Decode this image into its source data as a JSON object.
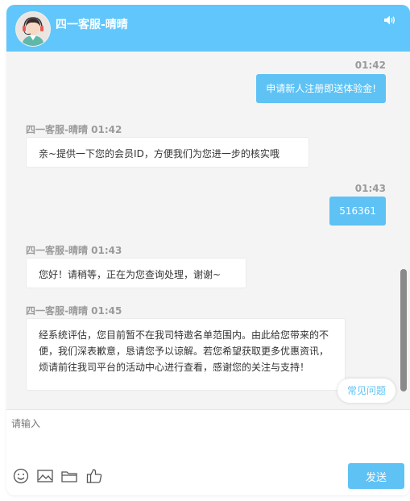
{
  "header": {
    "agent_name": "四一客服-晴晴",
    "avatar_icon": "agent-avatar-icon",
    "sound_icon": "speaker-icon",
    "background_color": "#61c6fb"
  },
  "messages": [
    {
      "from": "user",
      "time": "01:42",
      "text": "申请新人注册即送体验金!"
    },
    {
      "from": "agent",
      "meta": "四一客服-晴晴 01:42",
      "text": "亲~提供一下您的会员ID，方便我们为您进一步的核实哦"
    },
    {
      "from": "user",
      "time": "01:43",
      "text": "516361"
    },
    {
      "from": "agent",
      "meta": "四一客服-晴晴 01:43",
      "text": "您好！请稍等，正在为您查询处理，谢谢~"
    },
    {
      "from": "agent",
      "meta": "四一客服-晴晴 01:45",
      "text": "经系统评估，您目前暂不在我司特邀名单范围内。由此给您带来的不便，我们深表歉意，恳请您予以谅解。若您希望获取更多优惠资讯，烦请前往我司平台的活动中心进行查看，感谢您的关注与支持！"
    }
  ],
  "faq_label": "常见问题",
  "input": {
    "placeholder": "请输入",
    "value": ""
  },
  "toolbar": {
    "icons": [
      "emoji-icon",
      "image-icon",
      "folder-icon",
      "thumbs-up-icon"
    ],
    "send_label": "发送"
  },
  "colors": {
    "accent": "#5ec2f5",
    "chat_background": "#f4f4f4"
  }
}
